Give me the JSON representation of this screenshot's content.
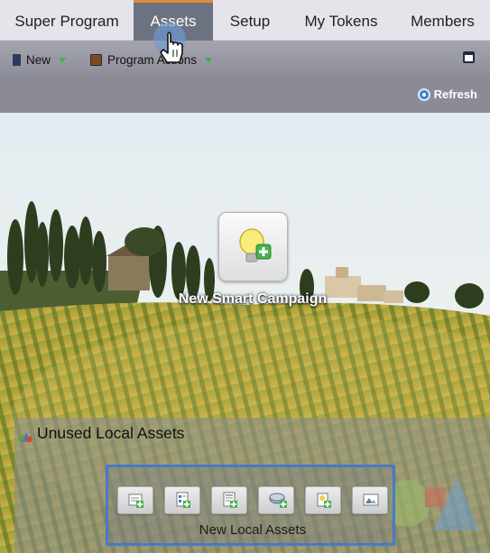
{
  "tabs": [
    {
      "label": "Super Program",
      "active": false
    },
    {
      "label": "Assets",
      "active": true
    },
    {
      "label": "Setup",
      "active": false
    },
    {
      "label": "My Tokens",
      "active": false
    },
    {
      "label": "Members",
      "active": false
    }
  ],
  "toolbar": {
    "new_label": "New",
    "program_actions_label": "Program Actions",
    "panel_icon": "window-layout-icon"
  },
  "refresh_label": "Refresh",
  "smart_campaign": {
    "label": "New Smart Campaign",
    "icon": "lightbulb-add-icon"
  },
  "unused_assets": {
    "title": "Unused Local Assets",
    "new_local_label": "New Local Assets",
    "buttons": [
      {
        "icon": "new-email-icon"
      },
      {
        "icon": "new-form-icon"
      },
      {
        "icon": "new-landing-page-icon"
      },
      {
        "icon": "new-list-icon"
      },
      {
        "icon": "new-report-icon"
      },
      {
        "icon": "new-image-icon"
      }
    ]
  },
  "colors": {
    "accent_tab_border": "#e08a3a",
    "highlight_box": "#4a78c8",
    "add_green": "#3db14a"
  }
}
